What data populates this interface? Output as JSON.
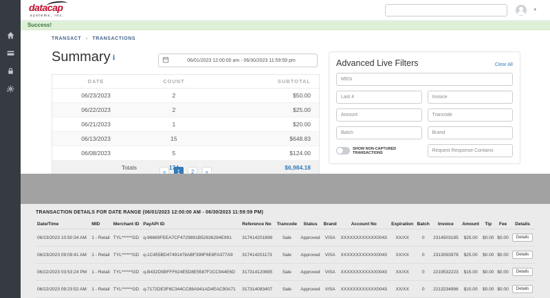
{
  "colors": {
    "accent": "#337ab7",
    "brand_red": "#c00c2d",
    "sidebar_bg": "#363b41",
    "success_bg": "#dff0d8",
    "success_text": "#3c763d",
    "band_gray": "#a2a2a2",
    "details_bg": "#ebebeb"
  },
  "icons": {
    "summary_info": "ℹ",
    "caret_down": "▾",
    "sidebar": [
      "home-icon",
      "credit-card-icon",
      "lock-icon",
      "gear-icon"
    ],
    "calendar": "calendar-icon",
    "user": "user-icon"
  },
  "header": {
    "logo_main": "datacap",
    "logo_sub": "systems, inc."
  },
  "alert": {
    "message": "Success!"
  },
  "breadcrumb": {
    "items": [
      "TRANSACT",
      "TRANSACTIONS"
    ],
    "separator": "›"
  },
  "summary": {
    "title": "Summary",
    "date_range": "06/01/2023 12:00:00 am - 06/30/2023 11:59:59 pm",
    "headers": [
      "DATE",
      "COUNT",
      "SUBTOTAL"
    ],
    "rows": [
      [
        "06/23/2023",
        "2",
        "$50.00"
      ],
      [
        "06/22/2023",
        "2",
        "$25.00"
      ],
      [
        "06/21/2023",
        "1",
        "$20.00"
      ],
      [
        "06/13/2023",
        "15",
        "$648.83"
      ],
      [
        "06/08/2023",
        "5",
        "$124.00"
      ]
    ],
    "totals": [
      "Totals",
      "174",
      "$6,984.18"
    ],
    "pagination": {
      "prev": "«",
      "pages": [
        "1",
        "2"
      ],
      "next": "»"
    }
  },
  "filters": {
    "title": "Advanced Live Filters",
    "clear_all": "Clear All",
    "placeholders": [
      "MIDs",
      "Last 4",
      "Invoice",
      "Amount",
      "Trancode",
      "Batch",
      "Brand",
      "Request Response Contains"
    ],
    "toggle_label": "SHOW NON-CAPTURED TRANSACTIONS"
  },
  "details": {
    "title": "TRANSACTION DETAILS FOR DATE RANGE (06/01/2023 12:00:00 AM - 06/30/2023 11:59:59 PM)",
    "headers": [
      "Date/Time",
      "MID",
      "Merchant ID",
      "PayAPI ID",
      "Reference No",
      "Trancode",
      "Status",
      "Brand",
      "Account No",
      "Expiration",
      "Batch",
      "Invoice",
      "Amount",
      "Tip",
      "Fee",
      "Details"
    ],
    "button_label": "Details",
    "rows": [
      [
        "06/23/2023 10:50:34 AM",
        "1 - Retail",
        "TYL******GD",
        "q-96669FEEA7CF4729891B52636294E991",
        "317414201898",
        "Sale",
        "Approved",
        "VISA",
        "XXXXXXXXXXXX0043",
        "XX/XX",
        "0",
        "2314503185",
        "$25.00",
        "$0.00",
        "$0.00"
      ],
      [
        "06/23/2023 09:09:41 AM",
        "1 - Retail",
        "TYL******GD",
        "q-1C455BD47491478ABF399F6E8FA377A9",
        "317414201173",
        "Sale",
        "Approved",
        "VISA",
        "XXXXXXXXXXXX0043",
        "XX/XX",
        "0",
        "2313093978",
        "$25.00",
        "$0.00",
        "$0.00"
      ],
      [
        "06/22/2023 03:53:24 PM",
        "1 - Retail",
        "TYL******GD",
        "q-B432D5BFFF624E5D8E5587F2CC944E6D",
        "317314120895",
        "Sale",
        "Approved",
        "VISA",
        "XXXXXXXXXXXX0043",
        "XX/XX",
        "0",
        "2219532223",
        "$15.00",
        "$0.00",
        "$0.00"
      ],
      [
        "06/22/2023 09:23:52 AM",
        "1 - Retail",
        "TYL******GD",
        "q-7172DE3F6C344CC88A941AD4EAC90A71",
        "317314083407",
        "Sale",
        "Approved",
        "VISA",
        "XXXXXXXXXXXX0043",
        "XX/XX",
        "0",
        "2213234996",
        "$10.00",
        "$0.00",
        "$0.00"
      ]
    ]
  }
}
